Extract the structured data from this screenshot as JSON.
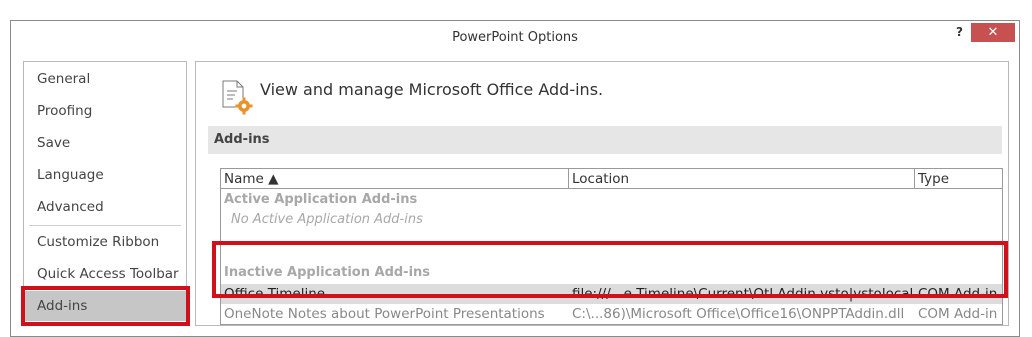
{
  "window": {
    "title": "PowerPoint Options",
    "help_label": "?",
    "close_label": "✕"
  },
  "sidebar": {
    "items": [
      {
        "label": "General"
      },
      {
        "label": "Proofing"
      },
      {
        "label": "Save"
      },
      {
        "label": "Language"
      },
      {
        "label": "Advanced"
      },
      {
        "label": "Customize Ribbon"
      },
      {
        "label": "Quick Access Toolbar"
      },
      {
        "label": "Add-ins",
        "selected": true
      }
    ]
  },
  "main": {
    "heading": "View and manage Microsoft Office Add-ins.",
    "section_label": "Add-ins",
    "table": {
      "columns": [
        "Name ▲",
        "Location",
        "Type"
      ],
      "active_group_label": "Active Application Add-ins",
      "active_empty_label": "No Active Application Add-ins",
      "inactive_group_label": "Inactive Application Add-ins",
      "rows": [
        {
          "name": "Office Timeline",
          "location": "file:///...e Timeline\\Current\\Otl.Addin.vsto|vstolocal",
          "type": "COM Add-in",
          "selected": true
        },
        {
          "name": "OneNote Notes about PowerPoint Presentations",
          "location": "C:\\...86)\\Microsoft Office\\Office16\\ONPPTAddin.dll",
          "type": "COM Add-in",
          "selected": false
        }
      ]
    }
  },
  "colors": {
    "highlight_border": "#d0111b",
    "close_button": "#c75050",
    "selection": "#c6c6c6"
  }
}
